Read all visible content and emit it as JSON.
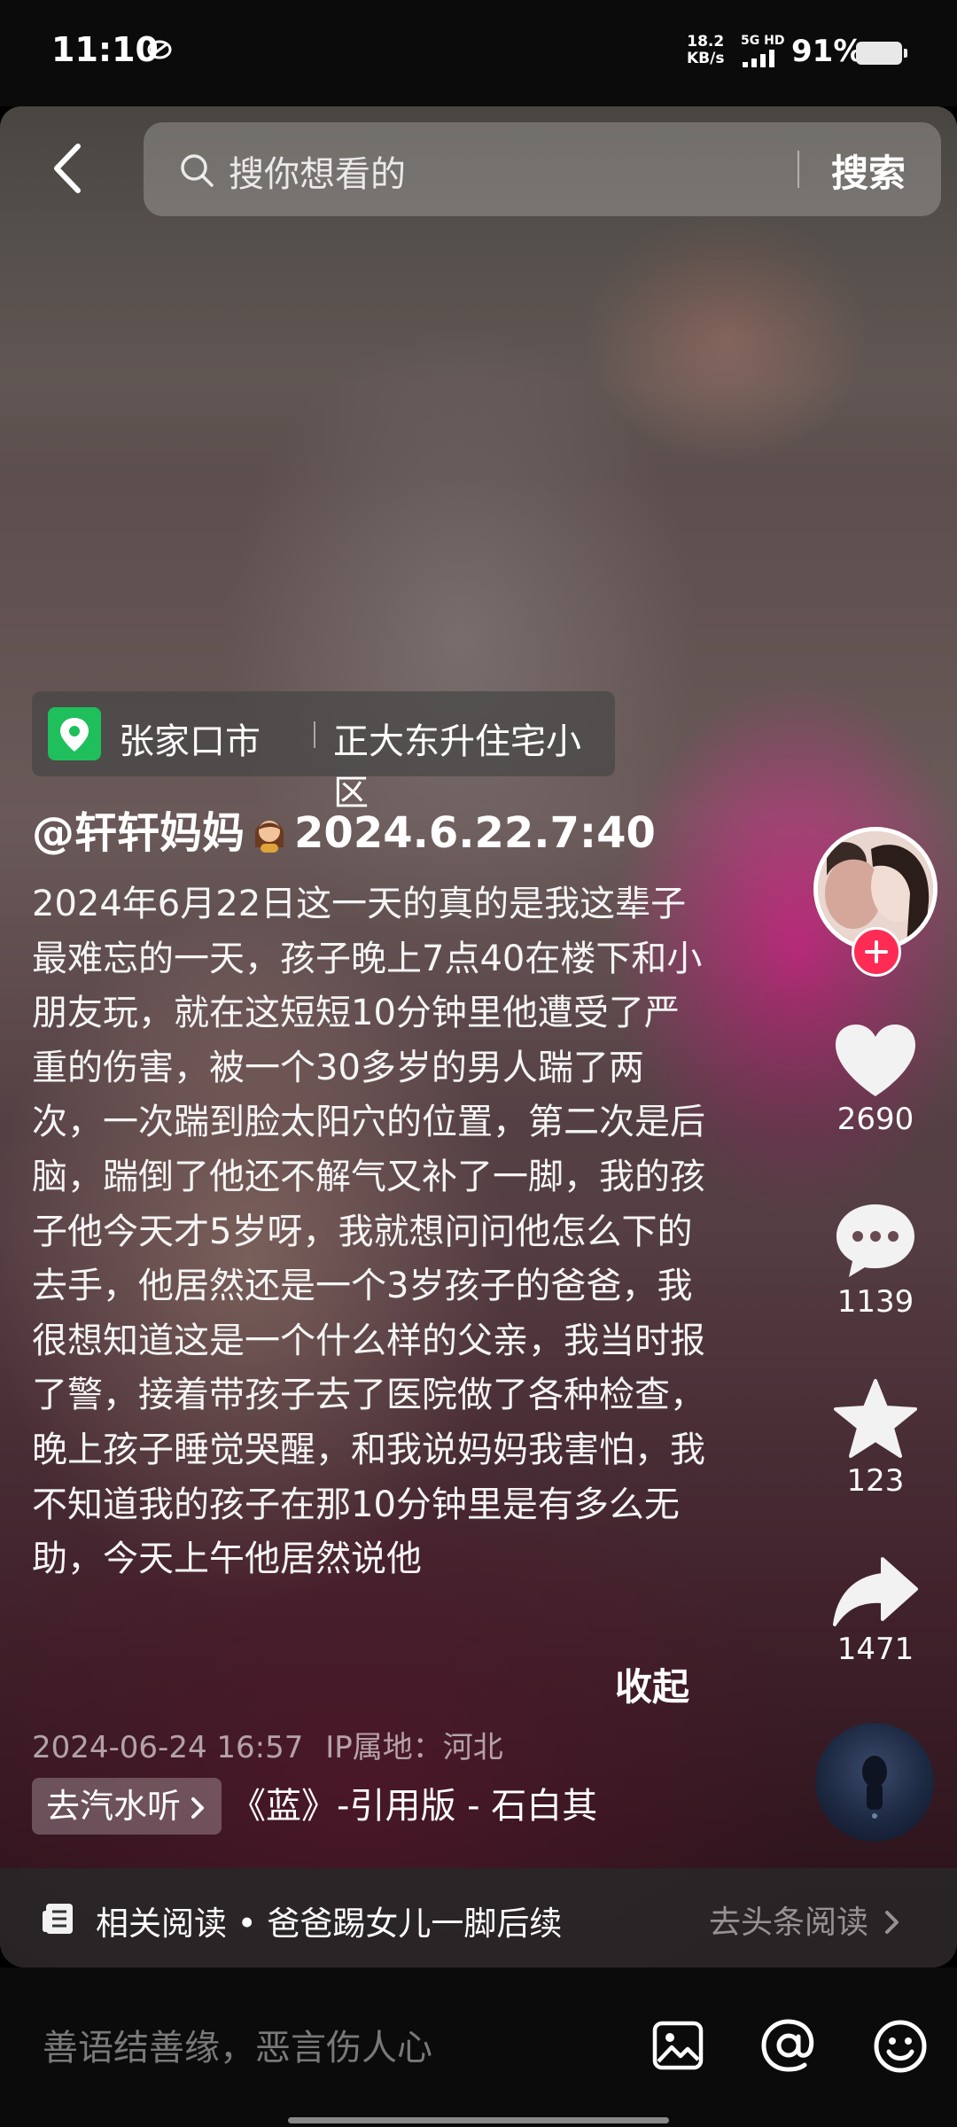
{
  "status_bar": {
    "time": "11:10",
    "net_speed_value": "18.2",
    "net_speed_unit": "KB/s",
    "network": "5G HD",
    "battery": "91%"
  },
  "search": {
    "placeholder": "搜你想看的",
    "button": "搜索"
  },
  "location": {
    "city": "张家口市",
    "place": "正大东升住宅小区"
  },
  "post": {
    "author": "@轩轩妈妈",
    "author_suffix": "2024.6.22.7:40",
    "description": "2024年6月22日这一天的真的是我这辈子最难忘的一天，孩子晚上7点40在楼下和小朋友玩，就在这短短10分钟里他遭受了严重的伤害，被一个30多岁的男人踹了两次，一次踹到脸太阳穴的位置，第二次是后脑，踹倒了他还不解气又补了一脚，我的孩子他今天才5岁呀，我就想问问他怎么下的去手，他居然还是一个3岁孩子的爸爸，我很想知道这是一个什么样的父亲，我当时报了警，接着带孩子去了医院做了各种检查，晚上孩子睡觉哭醒，和我说妈妈我害怕，我不知道我的孩子在那10分钟里是有多么无助，今天上午他居然说他",
    "collapse": "收起",
    "time": "2024-06-24 16:57",
    "ip_location": "IP属地：河北"
  },
  "music": {
    "button": "去汽水听",
    "title": "《蓝》-引用版 - 石白其"
  },
  "actions": {
    "likes": "2690",
    "comments": "1139",
    "favorites": "123",
    "shares": "1471"
  },
  "related": {
    "text": "相关阅读 • 爸爸踢女儿一脚后续",
    "link": "去头条阅读"
  },
  "comment": {
    "placeholder": "善语结善缘，恶言伤人心"
  },
  "colors": {
    "accent_red": "#fe2c55",
    "location_green": "#1fbf5b"
  },
  "icons": [
    "back-arrow-icon",
    "search-icon",
    "location-pin-icon",
    "heart-icon",
    "comment-icon",
    "star-icon",
    "share-icon",
    "article-icon",
    "chevron-right-icon",
    "image-icon",
    "at-icon",
    "emoji-icon"
  ]
}
